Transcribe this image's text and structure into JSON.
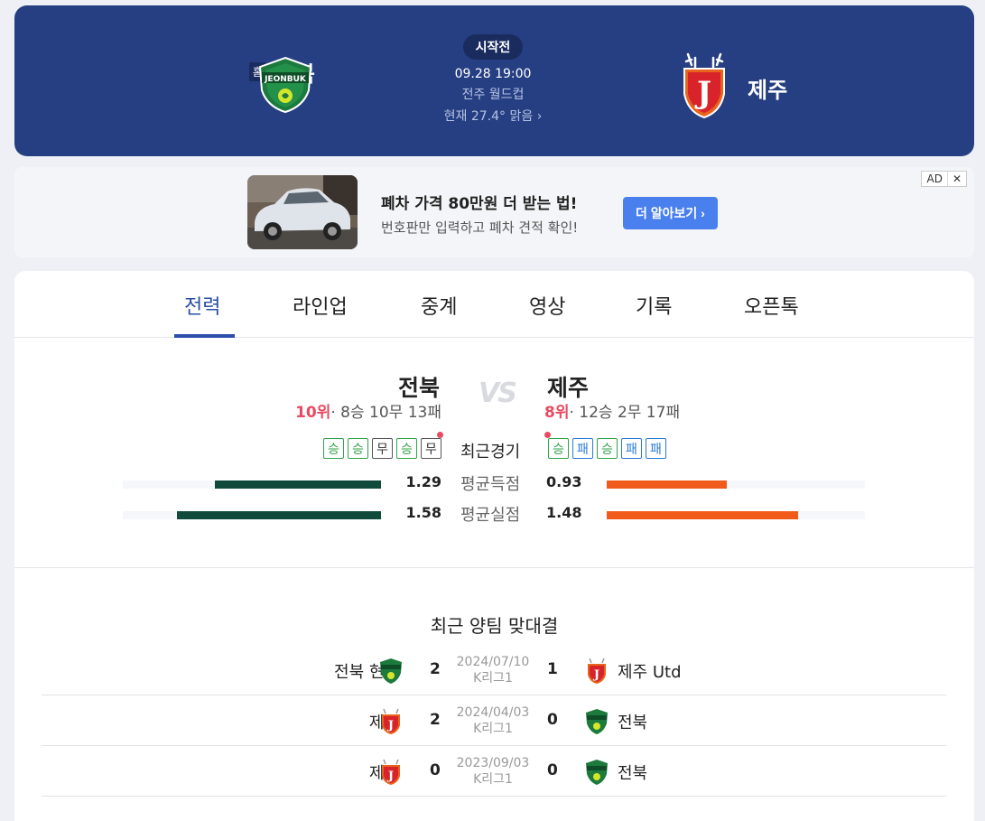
{
  "header": {
    "home_badge": "홈",
    "home_team": "전북",
    "away_team": "제주",
    "status": "시작전",
    "datetime": "09.28 19:00",
    "venue": "전주 월드컵",
    "weather": "현재 27.4° 맑음 ›",
    "home_logo_text": "JEONBUK",
    "away_logo_text": "J"
  },
  "ad": {
    "title": "폐차 가격 80만원 더 받는 법!",
    "description": "번호판만 입력하고 폐차 견적 확인!",
    "cta": "더 알아보기 ›",
    "tag": "AD",
    "close": "✕"
  },
  "tabs": [
    "전력",
    "라인업",
    "중계",
    "영상",
    "기록",
    "오픈톡"
  ],
  "comparison": {
    "home_name": "전북",
    "away_name": "제주",
    "vs": "VS",
    "home_rank": "10위",
    "home_record": "· 8승 10무 13패",
    "away_rank": "8위",
    "away_record": "· 12승 2무 17패",
    "recent_label": "최근경기",
    "home_form": [
      "승",
      "승",
      "무",
      "승",
      "무"
    ],
    "away_form": [
      "승",
      "패",
      "승",
      "패",
      "패"
    ],
    "stats": [
      {
        "label": "평균득점",
        "home": "1.29",
        "away": "0.93",
        "home_value": 1.29,
        "away_value": 0.93
      },
      {
        "label": "평균실점",
        "home": "1.58",
        "away": "1.48",
        "home_value": 1.58,
        "away_value": 1.48
      }
    ],
    "colors": {
      "home": "#0f4a3a",
      "away": "#f05a1a",
      "win": "#2fa44a",
      "loss": "#2a7ad8"
    }
  },
  "h2h": {
    "title": "최근 양팀 맞대결",
    "matches": [
      {
        "home": "전북 현대",
        "home_logo": "jeonbuk-logo",
        "home_score": "2",
        "date": "2024/07/10",
        "league": "K리그1",
        "away_score": "1",
        "away": "제주 Utd",
        "away_logo": "jeju-logo"
      },
      {
        "home": "제주",
        "home_logo": "jeju-logo",
        "home_score": "2",
        "date": "2024/04/03",
        "league": "K리그1",
        "away_score": "0",
        "away": "전북",
        "away_logo": "jeonbuk-logo"
      },
      {
        "home": "제주",
        "home_logo": "jeju-logo",
        "home_score": "0",
        "date": "2023/09/03",
        "league": "K리그1",
        "away_score": "0",
        "away": "전북",
        "away_logo": "jeonbuk-logo"
      }
    ]
  }
}
